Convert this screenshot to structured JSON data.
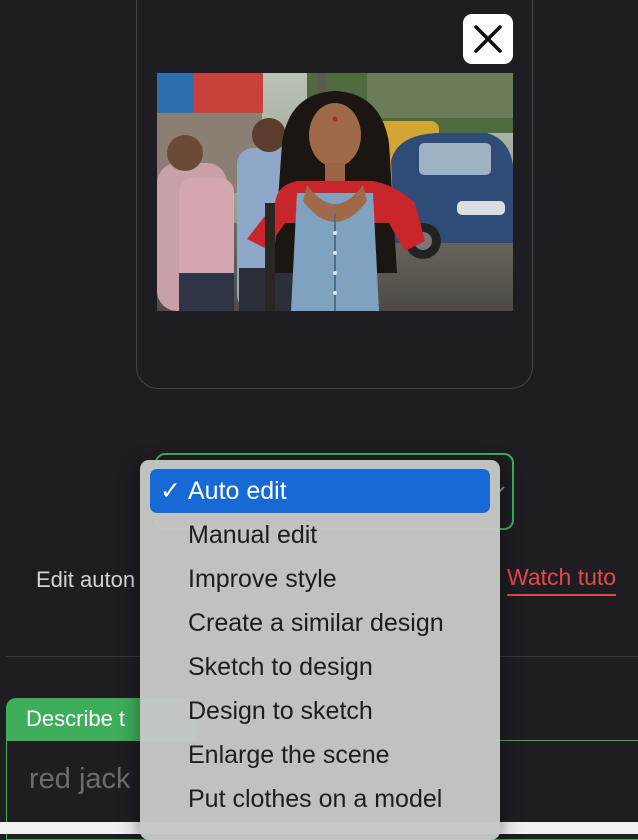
{
  "upload": {
    "close_icon": "close-x-icon",
    "preview_alt": ""
  },
  "mode_select": {
    "options": [
      {
        "label": "Auto edit",
        "selected": true
      },
      {
        "label": "Manual edit",
        "selected": false
      },
      {
        "label": "Improve style",
        "selected": false
      },
      {
        "label": "Create a similar design",
        "selected": false
      },
      {
        "label": "Sketch to design",
        "selected": false
      },
      {
        "label": "Design to sketch",
        "selected": false
      },
      {
        "label": "Enlarge the scene",
        "selected": false
      },
      {
        "label": "Put clothes on a model",
        "selected": false
      }
    ],
    "check_glyph": "✓"
  },
  "info": {
    "edit_text": "Edit auton",
    "watch_link": "Watch tuto"
  },
  "prompt": {
    "tab_label": "Describe t",
    "input_text": "red jack"
  },
  "colors": {
    "accent_green": "#3fae5a",
    "link_red": "#e5484d",
    "selected_blue": "#1769d6",
    "background": "#1e1e22"
  }
}
